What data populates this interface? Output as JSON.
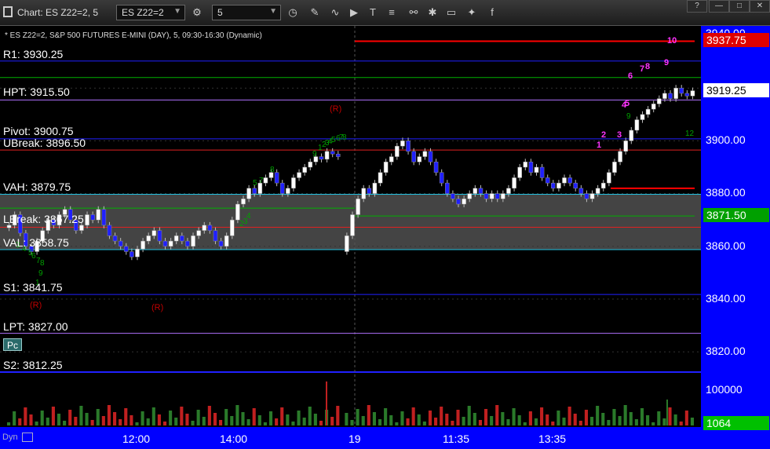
{
  "window": {
    "title": "Chart: ES Z22=2, 5",
    "symbol": "ES Z22=2",
    "interval": "5"
  },
  "chart_header": "* ES Z22=2, S&P 500 FUTURES E-MINI (DAY), 5, 09:30-16:30 (Dynamic)",
  "levels": [
    {
      "label": "R1: 3930.25",
      "price": 3930.25,
      "color": "#2020ff"
    },
    {
      "label": "HPT: 3915.50",
      "price": 3915.5,
      "color": "#b070ff"
    },
    {
      "label": "Pivot: 3900.75",
      "price": 3900.75,
      "color": "#2020ff"
    },
    {
      "label": "UBreak: 3896.50",
      "price": 3896.5,
      "color": "#e02020"
    },
    {
      "label": "VAH: 3879.75",
      "price": 3879.75,
      "color": "#20c0e0"
    },
    {
      "label": "LBreak: 3867.25",
      "price": 3867.25,
      "color": "#e02020"
    },
    {
      "label": "VAL: 3858.75",
      "price": 3858.75,
      "color": "#20c0e0"
    },
    {
      "label": "S1: 3841.75",
      "price": 3841.75,
      "color": "#2020ff"
    },
    {
      "label": "LPT: 3827.00",
      "price": 3827.0,
      "color": "#b070ff"
    },
    {
      "label": "S2: 3812.25",
      "price": 3812.25,
      "color": "#2020ff"
    }
  ],
  "price_axis": {
    "ticks": [
      "3940.00",
      "3900.00",
      "3880.00",
      "3860.00",
      "3840.00",
      "3820.00"
    ],
    "current_price": "3919.25",
    "high_marker": "3937.75",
    "poc_marker": "3871.50",
    "volume_tick": "100000",
    "volume_current": "1064"
  },
  "time_axis": {
    "ticks": [
      "12:00",
      "14:00",
      "19",
      "11:35",
      "13:35"
    ]
  },
  "markers": {
    "r_labels": [
      "(R)",
      "(R)",
      "(R)"
    ],
    "pc_label": "Pc",
    "dyn_label": "Dyn"
  },
  "chart_data": {
    "type": "candlestick",
    "y_range": [
      3807,
      3942
    ],
    "volume_ylim": [
      0,
      120000
    ],
    "session_split_time": "19",
    "value_area": [
      3858.75,
      3879.75
    ],
    "counts_green": [
      "3",
      "4",
      "5",
      "6",
      "7",
      "8",
      "9",
      "1",
      "2",
      "3",
      "4",
      "5",
      "7",
      "8",
      "9",
      "1",
      "2",
      "3",
      "4",
      "5",
      "6",
      "7",
      "8",
      "9",
      "12"
    ],
    "counts_magenta": [
      "1",
      "2",
      "3",
      "4",
      "5",
      "6",
      "7",
      "8",
      "9",
      "10"
    ]
  },
  "colors": {
    "up_candle": "#ffffff",
    "down_candle": "#2020ff",
    "axis_bg": "#0000ff",
    "green_marker": "#00a000",
    "red_marker": "#ff0000",
    "volume_bar": "#c02020"
  }
}
